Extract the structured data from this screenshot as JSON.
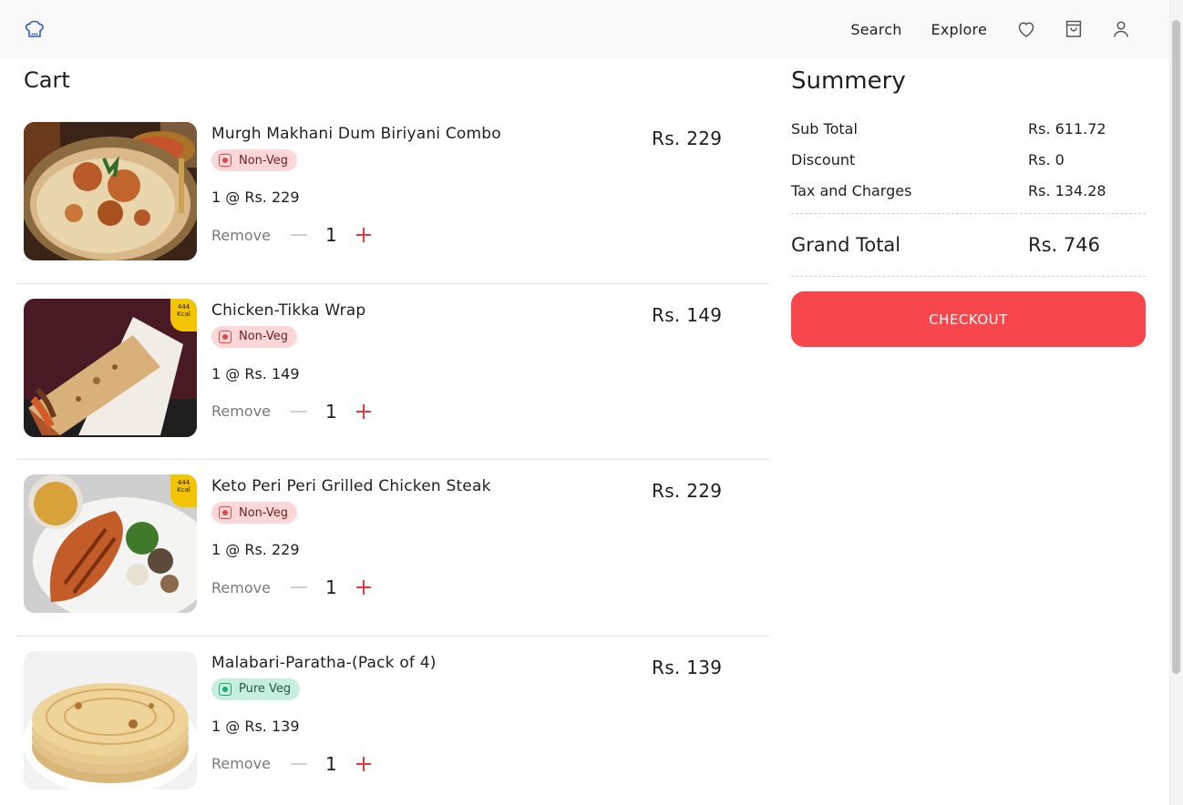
{
  "nav": {
    "links": [
      "Search",
      "Explore"
    ],
    "icons": [
      "chef-hat-icon",
      "heart-icon",
      "shopping-bag-icon",
      "user-icon"
    ]
  },
  "cart": {
    "title": "Cart",
    "remove_label": "Remove",
    "items": [
      {
        "name": "Murgh Makhani Dum Biriyani Combo",
        "badge": "Non-Veg",
        "qty_line": "1 @ Rs. 229",
        "count": "1",
        "price": "Rs. 229"
      },
      {
        "name": "Chicken-Tikka Wrap",
        "badge": "Non-Veg",
        "qty_line": "1 @ Rs. 149",
        "count": "1",
        "price": "Rs. 149",
        "kcal": [
          "444",
          "Kcal"
        ]
      },
      {
        "name": "Keto Peri Peri Grilled Chicken Steak",
        "badge": "Non-Veg",
        "qty_line": "1 @ Rs. 229",
        "count": "1",
        "price": "Rs. 229",
        "kcal": [
          "444",
          "Kcal"
        ]
      },
      {
        "name": "Malabari-Paratha-(Pack of 4)",
        "badge": "Pure Veg",
        "qty_line": "1 @ Rs. 139",
        "count": "1",
        "price": "Rs. 139"
      }
    ]
  },
  "summary": {
    "title": "Summery",
    "rows": [
      {
        "label": "Sub Total",
        "value": "Rs. 611.72"
      },
      {
        "label": "Discount",
        "value": "Rs. 0"
      },
      {
        "label": "Tax and Charges",
        "value": "Rs. 134.28"
      }
    ],
    "grand_label": "Grand Total",
    "grand_value": "Rs. 746",
    "checkout_label": "CHECKOUT"
  },
  "colors": {
    "accent": "#f8474c",
    "nonveg_badge": "#fbd7d7",
    "veg_badge": "#c7efdd",
    "kcal_tag": "#f5c400"
  }
}
